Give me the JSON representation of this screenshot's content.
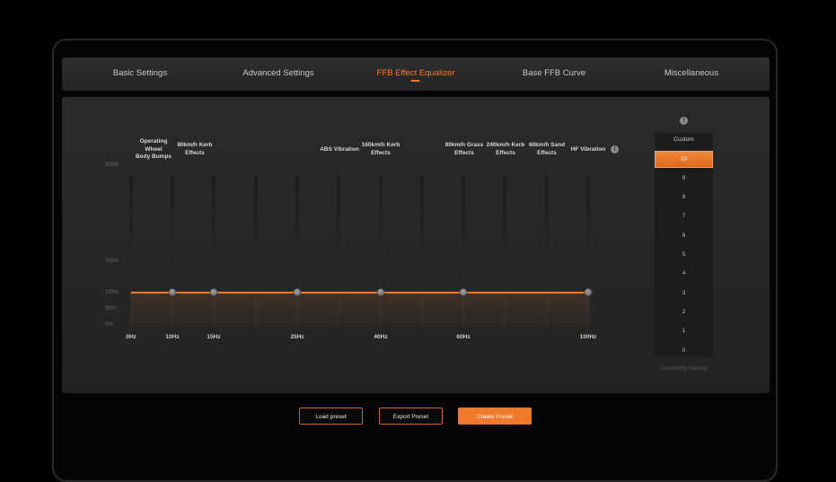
{
  "tabs": [
    {
      "label": "Basic Settings",
      "active": false
    },
    {
      "label": "Advanced Settings",
      "active": false
    },
    {
      "label": "FFB Effect Equalizer",
      "active": true
    },
    {
      "label": "Base FFB Curve",
      "active": false
    },
    {
      "label": "Miscellaneous",
      "active": false
    }
  ],
  "equalizer": {
    "y_ticks": [
      "300%",
      "200%",
      "100%",
      "50%",
      "0%"
    ],
    "x_ticks": [
      "0Hz",
      "10Hz",
      "15Hz",
      "25Hz",
      "40Hz",
      "60Hz",
      "100Hz"
    ],
    "bands": [
      {
        "label_lines": [
          "Operating",
          "Wheel",
          "Body Bumps"
        ],
        "value_percent": 100
      },
      {
        "label_lines": [
          "80km/h Kerb",
          "Effects"
        ],
        "value_percent": 100
      },
      {
        "label_lines": [
          "ABS Vibration"
        ],
        "value_percent": 100
      },
      {
        "label_lines": [
          "160km/h Kerb",
          "Effects"
        ],
        "value_percent": 100
      },
      {
        "label_lines": [
          "80km/h Grass",
          "Effects"
        ],
        "value_percent": 100
      },
      {
        "label_lines": [
          "240km/h Kerb",
          "Effects"
        ],
        "value_percent": 100
      },
      {
        "label_lines": [
          "60km/h Sand",
          "Effects"
        ],
        "value_percent": 100
      },
      {
        "label_lines": [
          "HF Vibration"
        ],
        "value_percent": 100
      }
    ],
    "accent_color": "#f07a2c"
  },
  "sensitivity": {
    "title": "Custom",
    "options": [
      "10",
      "9",
      "8",
      "7",
      "6",
      "5",
      "4",
      "3",
      "2",
      "1",
      "0"
    ],
    "selected": "10",
    "caption": "Sensitivity Setting"
  },
  "buttons": {
    "load": "Load preset",
    "export": "Export Preset",
    "create": "Create Preset"
  }
}
